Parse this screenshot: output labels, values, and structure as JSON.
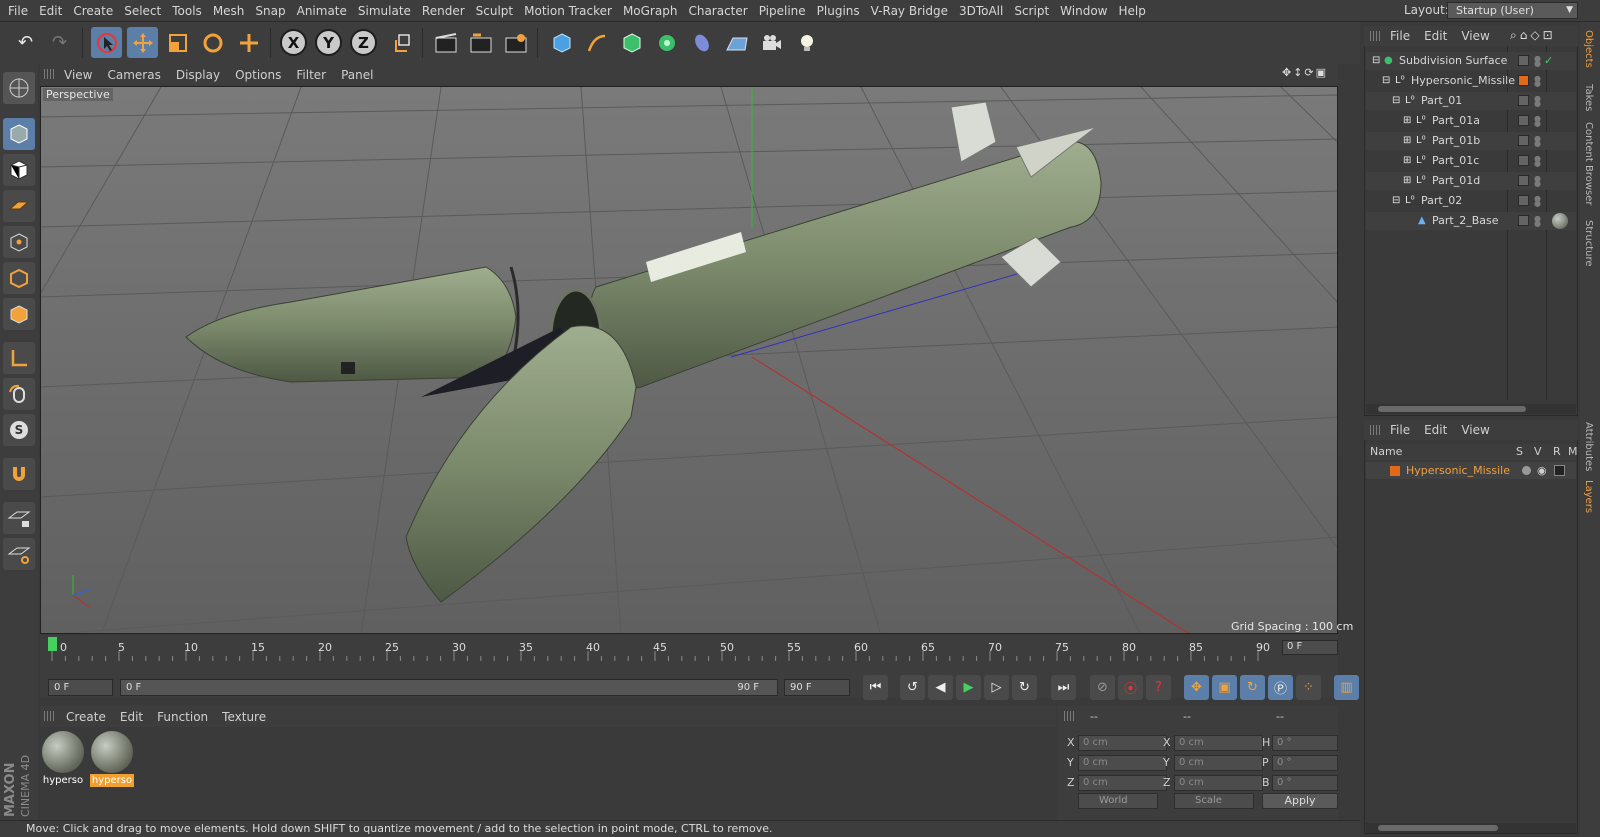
{
  "menubar": {
    "items": [
      "File",
      "Edit",
      "Create",
      "Select",
      "Tools",
      "Mesh",
      "Snap",
      "Animate",
      "Simulate",
      "Render",
      "Sculpt",
      "Motion Tracker",
      "MoGraph",
      "Character",
      "Pipeline",
      "Plugins",
      "V-Ray Bridge",
      "3DToAll",
      "Script",
      "Window",
      "Help"
    ],
    "layout_label": "Layout:",
    "layout_value": "Startup (User)"
  },
  "toolbar": {
    "icons": [
      "undo-icon",
      "redo-icon",
      "select-arrow-icon",
      "move-icon",
      "scale-icon",
      "rotate-icon",
      "live-select-icon",
      "x-axis-icon",
      "y-axis-icon",
      "z-axis-icon",
      "world-coord-icon",
      "render-view-icon",
      "render-picture-viewer-icon",
      "edit-render-settings-icon",
      "cube-icon",
      "pen-icon",
      "subdivision-icon",
      "cloner-icon",
      "deformer-icon",
      "floor-icon",
      "camera-icon",
      "light-icon"
    ],
    "x_label": "X",
    "y_label": "Y",
    "z_label": "Z"
  },
  "viewport": {
    "menu": [
      "View",
      "Cameras",
      "Display",
      "Options",
      "Filter",
      "Panel"
    ],
    "camera_label": "Perspective",
    "grid_spacing": "Grid Spacing : 100 cm"
  },
  "timeline": {
    "ticks": [
      "0",
      "5",
      "10",
      "15",
      "20",
      "25",
      "30",
      "35",
      "40",
      "45",
      "50",
      "55",
      "60",
      "65",
      "70",
      "75",
      "80",
      "85",
      "90"
    ],
    "current_frame": "0 F",
    "start_field": "0 F",
    "range_start": "0 F",
    "range_end": "90 F",
    "end_field": "90 F"
  },
  "material_manager": {
    "menu": [
      "Create",
      "Edit",
      "Function",
      "Texture"
    ],
    "materials": [
      {
        "label": "hyperso",
        "selected": false
      },
      {
        "label": "hyperso",
        "selected": true
      }
    ]
  },
  "coordinates": {
    "header_cols": [
      "--",
      "--",
      "--"
    ],
    "rows": [
      {
        "axis": "X",
        "pos": "0 cm",
        "axis2": "X",
        "size": "0 cm",
        "axis3": "H",
        "rot": "0 °"
      },
      {
        "axis": "Y",
        "pos": "0 cm",
        "axis2": "Y",
        "size": "0 cm",
        "axis3": "P",
        "rot": "0 °"
      },
      {
        "axis": "Z",
        "pos": "0 cm",
        "axis2": "Z",
        "size": "0 cm",
        "axis3": "B",
        "rot": "0 °"
      }
    ],
    "mode_world": "World",
    "mode_scale": "Scale",
    "apply_label": "Apply"
  },
  "status": "Move: Click and drag to move elements. Hold down SHIFT to quantize movement / add to the selection in point mode, CTRL to remove.",
  "brand": {
    "line1": "MAXON",
    "line2": "CINEMA 4D"
  },
  "object_manager": {
    "menu": [
      "File",
      "Edit",
      "View"
    ],
    "objects": [
      {
        "name": "Subdivision Surface",
        "indent": 0,
        "icon": "subdivision-icon"
      },
      {
        "name": "Hypersonic_Missile",
        "indent": 1,
        "icon": "null-icon"
      },
      {
        "name": "Part_01",
        "indent": 2,
        "icon": "null-icon"
      },
      {
        "name": "Part_01a",
        "indent": 3,
        "icon": "null-icon"
      },
      {
        "name": "Part_01b",
        "indent": 3,
        "icon": "null-icon"
      },
      {
        "name": "Part_01c",
        "indent": 3,
        "icon": "null-icon"
      },
      {
        "name": "Part_01d",
        "indent": 3,
        "icon": "null-icon"
      },
      {
        "name": "Part_02",
        "indent": 2,
        "icon": "null-icon"
      },
      {
        "name": "Part_2_Base",
        "indent": 3,
        "icon": "polygon-icon"
      }
    ]
  },
  "layer_manager": {
    "menu": [
      "File",
      "Edit",
      "View"
    ],
    "columns": [
      "Name",
      "S",
      "V",
      "R",
      "M"
    ],
    "layers": [
      {
        "name": "Hypersonic_Missile",
        "color": "#e06a1a"
      }
    ]
  },
  "side_tabs": [
    "Objects",
    "Takes",
    "Content Browser",
    "Structure",
    "Attributes",
    "Layers"
  ],
  "colors": {
    "accent": "#5b7fa8",
    "layer_orange": "#e06a1a",
    "model_green": "#7c8a6c"
  }
}
